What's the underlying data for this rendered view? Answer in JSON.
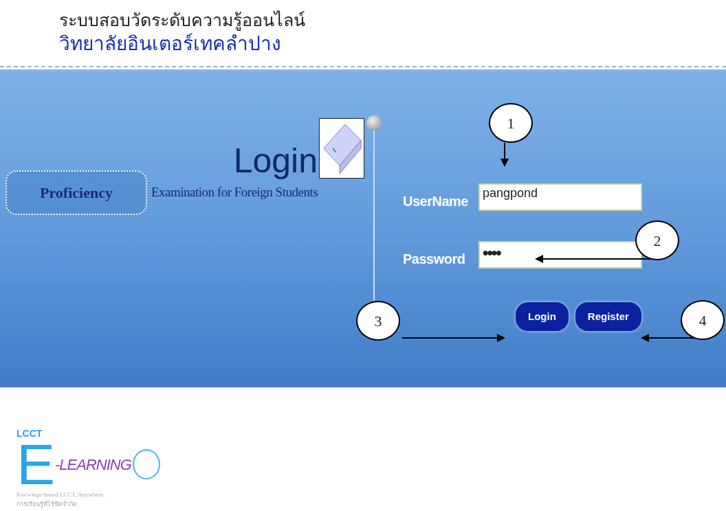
{
  "header": {
    "title": "ระบบสอบวัดระดับความรู้ออนไลน์",
    "subtitle": "วิทยาลัยอินเตอร์เทคลำปาง"
  },
  "banner": {
    "login_title": "Login",
    "badge": "Proficiency",
    "tagline": "Examination for Foreign Students"
  },
  "form": {
    "fields": [
      {
        "label": "UserName",
        "value": "pangpond",
        "kind": "text"
      },
      {
        "label": "Password",
        "value": "••••",
        "kind": "password"
      }
    ],
    "buttons": [
      "Login",
      "Register"
    ]
  },
  "callouts": [
    "1",
    "2",
    "3",
    "4"
  ],
  "footer_logo": {
    "brand": "LCCT",
    "letter": "E",
    "word": "-LEARNING",
    "slogan": "Knowlege-based LCCT, Anywhere.",
    "thai_slogan": "การเรียนรู้ที่ไร้ขีดจำกัด"
  }
}
